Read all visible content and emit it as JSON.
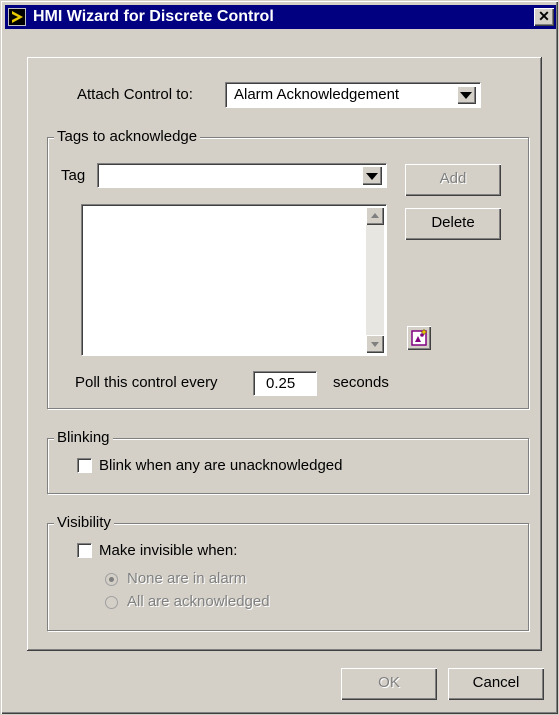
{
  "window": {
    "title": "HMI Wizard for Discrete Control",
    "close_glyph": "✕"
  },
  "attach": {
    "label": "Attach Control to:",
    "value": "Alarm Acknowledgement"
  },
  "tags_group": {
    "label": "Tags to acknowledge",
    "tag_label": "Tag",
    "tag_value": "",
    "add_label": "Add",
    "delete_label": "Delete",
    "tags_list": [],
    "poll_label": "Poll this control every",
    "poll_value": "0.25",
    "poll_unit": "seconds"
  },
  "blinking_group": {
    "label": "Blinking",
    "checkbox_label": "Blink when any are unacknowledged",
    "checked": false
  },
  "visibility_group": {
    "label": "Visibility",
    "checkbox_label": "Make invisible when:",
    "checked": false,
    "options": [
      {
        "label": "None are in alarm",
        "selected": true
      },
      {
        "label": "All are acknowledged",
        "selected": false
      }
    ]
  },
  "footer": {
    "ok_label": "OK",
    "cancel_label": "Cancel"
  },
  "colors": {
    "titlebar": "#000080",
    "face": "#d4d0c8",
    "disabled_text": "#808080"
  }
}
